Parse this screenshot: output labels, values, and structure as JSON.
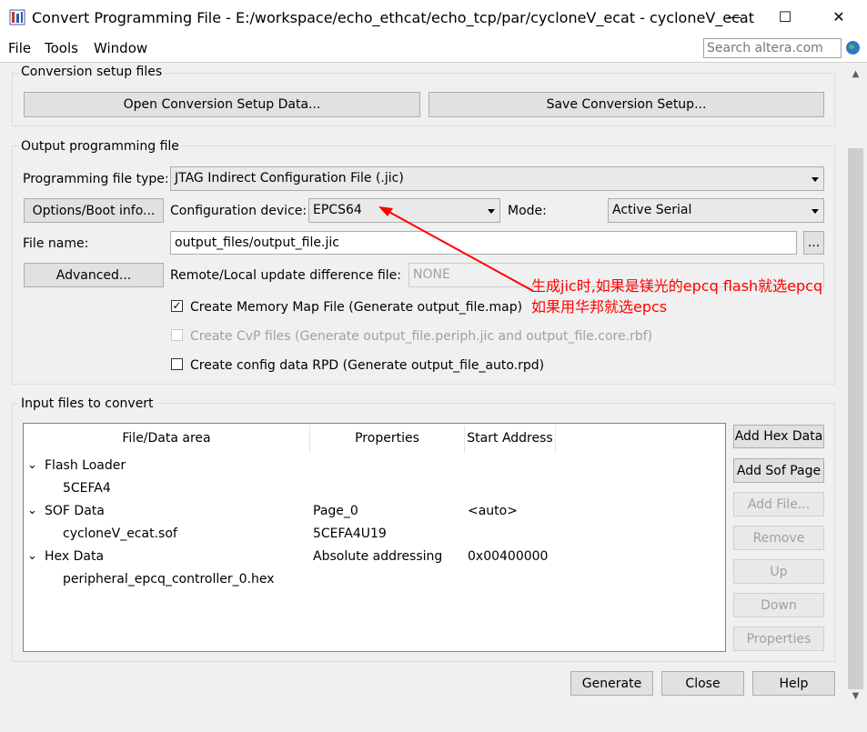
{
  "window": {
    "title": "Convert Programming File - E:/workspace/echo_ethcat/echo_tcp/par/cycloneV_ecat - cycloneV_ecat",
    "minimize": "—",
    "maximize": "☐",
    "close": "✕"
  },
  "menu": {
    "file": "File",
    "tools": "Tools",
    "window": "Window"
  },
  "search": {
    "placeholder": "Search altera.com"
  },
  "conversion_setup": {
    "title": "Conversion setup files",
    "open_button": "Open Conversion Setup Data...",
    "save_button": "Save Conversion Setup..."
  },
  "output": {
    "title": "Output programming file",
    "file_type_label": "Programming file type:",
    "file_type_value": "JTAG Indirect Configuration File (.jic)",
    "options_button": "Options/Boot info...",
    "config_device_label": "Configuration device:",
    "config_device_value": "EPCS64",
    "mode_label": "Mode:",
    "mode_value": "Active Serial",
    "file_name_label": "File name:",
    "file_name_value": "output_files/output_file.jic",
    "browse_button": "...",
    "advanced_button": "Advanced...",
    "remote_label": "Remote/Local update difference file:",
    "remote_value": "NONE",
    "memory_map_label": "Create Memory Map File (Generate output_file.map)",
    "memory_map_checked": true,
    "cvp_label": "Create CvP files (Generate output_file.periph.jic and output_file.core.rbf)",
    "rpd_label": "Create config data RPD (Generate output_file_auto.rpd)"
  },
  "input": {
    "title": "Input files to convert",
    "columns": [
      "File/Data area",
      "Properties",
      "Start Address"
    ],
    "rows": [
      {
        "name": "Flash Loader",
        "properties": "",
        "address": "",
        "expandable": true
      },
      {
        "name": "5CEFA4",
        "properties": "",
        "address": "",
        "expandable": false
      },
      {
        "name": "SOF Data",
        "properties": "Page_0",
        "address": "<auto>",
        "expandable": true
      },
      {
        "name": "cycloneV_ecat.sof",
        "properties": "5CEFA4U19",
        "address": "",
        "expandable": false
      },
      {
        "name": "Hex Data",
        "properties": "Absolute addressing",
        "address": "0x00400000",
        "expandable": true
      },
      {
        "name": "peripheral_epcq_controller_0.hex",
        "properties": "",
        "address": "",
        "expandable": false
      }
    ],
    "buttons": {
      "add_hex": "Add Hex Data",
      "add_sof": "Add Sof Page",
      "add_file": "Add File...",
      "remove": "Remove",
      "up": "Up",
      "down": "Down",
      "properties": "Properties"
    }
  },
  "footer": {
    "generate": "Generate",
    "close": "Close",
    "help": "Help"
  },
  "annotation": {
    "line1": "生成jic时,如果是镁光的epcq flash就选epcq",
    "line2": "如果用华邦就选epcs",
    "color": "#ff0000"
  }
}
